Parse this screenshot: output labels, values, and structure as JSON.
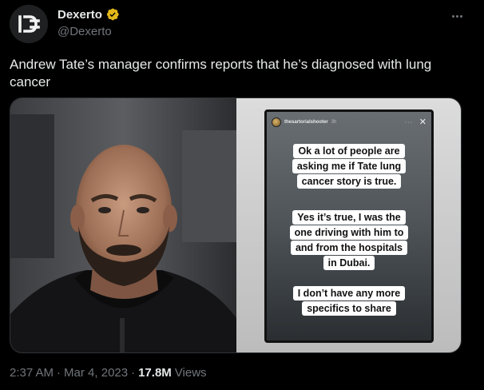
{
  "author": {
    "display_name": "Dexerto",
    "handle": "@Dexerto",
    "verified_color": "#e2b719",
    "avatar_icon": "dexerto-logo-icon"
  },
  "tweet": {
    "text": "Andrew Tate’s manager confirms reports that he’s diagnosed with lung cancer"
  },
  "media": {
    "left_image": "portrait-photo",
    "story": {
      "username": "thesartorialshooter",
      "time": "3h",
      "messages": [
        [
          "Ok a lot of people are",
          "asking me if Tate lung",
          "cancer story is true."
        ],
        [
          "Yes it’s true, I was the",
          "one driving with him to",
          "and from the hospitals",
          "in Dubai."
        ],
        [
          "I don’t have any more",
          "specifics to share"
        ]
      ]
    }
  },
  "meta": {
    "time": "2:37 AM",
    "separator": "·",
    "date": "Mar 4, 2023",
    "views_count": "17.8M",
    "views_label": "Views"
  }
}
